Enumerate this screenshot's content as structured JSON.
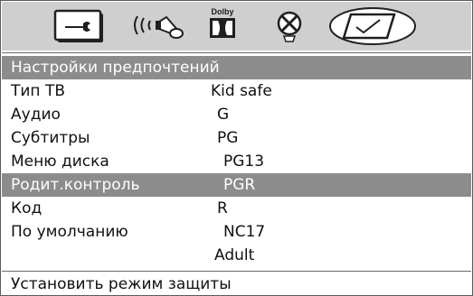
{
  "tabs": [
    {
      "name": "setup",
      "icon": "wrench-icon"
    },
    {
      "name": "audio",
      "icon": "speaker-sound-icon"
    },
    {
      "name": "dolby",
      "icon": "dolby-logo",
      "text": "Dolby"
    },
    {
      "name": "video",
      "icon": "tv-x-icon"
    },
    {
      "name": "preferences",
      "icon": "checkmark-screen-icon",
      "selected": true
    }
  ],
  "menu": {
    "title": "Настройки предпочтений",
    "items": [
      {
        "label": "Тип ТВ",
        "option": "Kid safe"
      },
      {
        "label": "Аудио",
        "option": "G"
      },
      {
        "label": "Субтитры",
        "option": "PG"
      },
      {
        "label": "Меню диска",
        "option": "PG13"
      },
      {
        "label": "Родит.контроль",
        "option": "PGR",
        "selected": true
      },
      {
        "label": "Код",
        "option": "R"
      },
      {
        "label": "По умолчанию",
        "option": "NC17"
      },
      {
        "label": "",
        "option": "Adult"
      }
    ]
  },
  "status": "Установить режим защиты",
  "colors": {
    "bar": "#cfcfcf",
    "highlight": "#8c8c8c",
    "text": "#111111"
  }
}
